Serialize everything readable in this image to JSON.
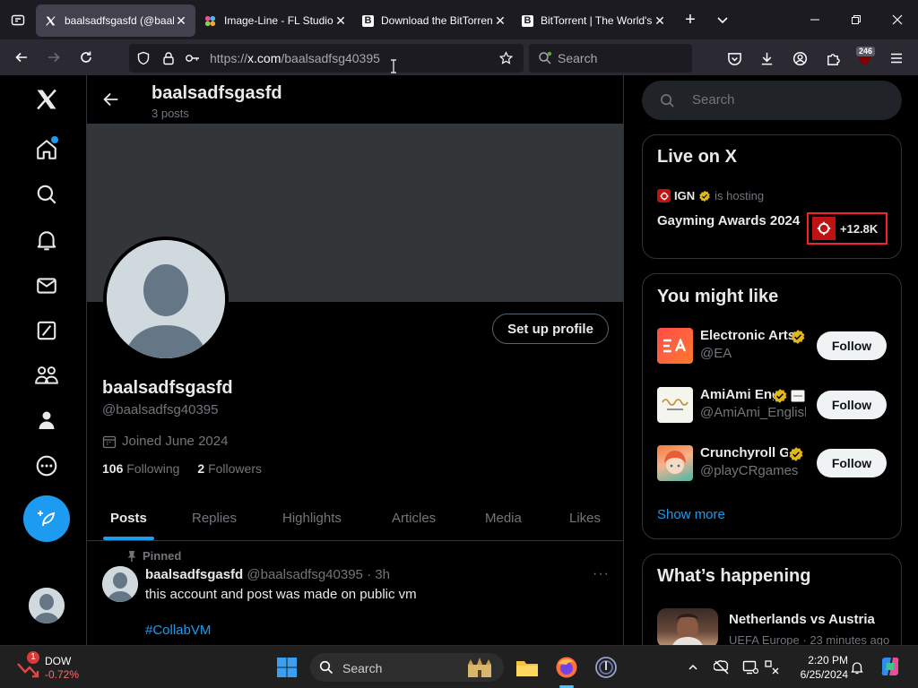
{
  "browser": {
    "tabs": [
      {
        "title": "baalsadfsgasfd (@baals",
        "active": true
      },
      {
        "title": "Image-Line - FL Studio",
        "active": false
      },
      {
        "title": "Download the BitTorrent",
        "active": false
      },
      {
        "title": "BitTorrent | The World's",
        "active": false
      }
    ],
    "url_scheme": "https://",
    "url_host": "x.com",
    "url_path": "/baalsadfsg40395",
    "search_placeholder": "Search",
    "extension_badge": "246",
    "close_glyph": "✕",
    "newtab_glyph": "+",
    "tabmenu_glyph": "⌄"
  },
  "profile": {
    "header_name": "baalsadfsgasfd",
    "post_count": "3 posts",
    "display_name": "baalsadfsgasfd",
    "handle": "@baalsadfsg40395",
    "joined": "Joined June 2024",
    "following_count": "106",
    "following_label": "Following",
    "followers_count": "2",
    "followers_label": "Followers",
    "setup_button": "Set up profile",
    "tabs": [
      "Posts",
      "Replies",
      "Highlights",
      "Articles",
      "Media",
      "Likes"
    ],
    "selected_tab": "Posts"
  },
  "post": {
    "pinned_label": "Pinned",
    "author": "baalsadfsgasfd",
    "handle": "@baalsadfsg40395",
    "separator": "·",
    "time": "3h",
    "text": "this account and post was made on public vm",
    "hashtag": "#CollabVM",
    "more": "···"
  },
  "sidebar": {
    "search_placeholder": "Search",
    "live": {
      "title": "Live on X",
      "host": "IGN",
      "hosting_label": "is hosting",
      "event": "Gayming Awards 2024",
      "listeners": "+12.8K"
    },
    "suggestions_title": "You might like",
    "suggestions": [
      {
        "name": "Electronic Arts",
        "handle": "@EA",
        "button": "Follow"
      },
      {
        "name": "AmiAmi English",
        "handle": "@AmiAmi_English",
        "button": "Follow"
      },
      {
        "name": "Crunchyroll Games",
        "handle": "@playCRgames",
        "button": "Follow"
      }
    ],
    "show_more": "Show more",
    "happening_title": "What’s happening",
    "trend": {
      "title": "Netherlands vs Austria",
      "meta": "UEFA Europe · 23 minutes ago"
    }
  },
  "taskbar": {
    "stock_name": "DOW",
    "stock_change": "-0.72%",
    "stock_badge": "1",
    "search_placeholder": "Search",
    "time": "2:20 PM",
    "date": "6/25/2024"
  },
  "colors": {
    "accent": "#1d9bf0",
    "background": "#000000",
    "text": "#e7e9ea",
    "muted": "#71767b",
    "live_border": "#f4212e"
  }
}
